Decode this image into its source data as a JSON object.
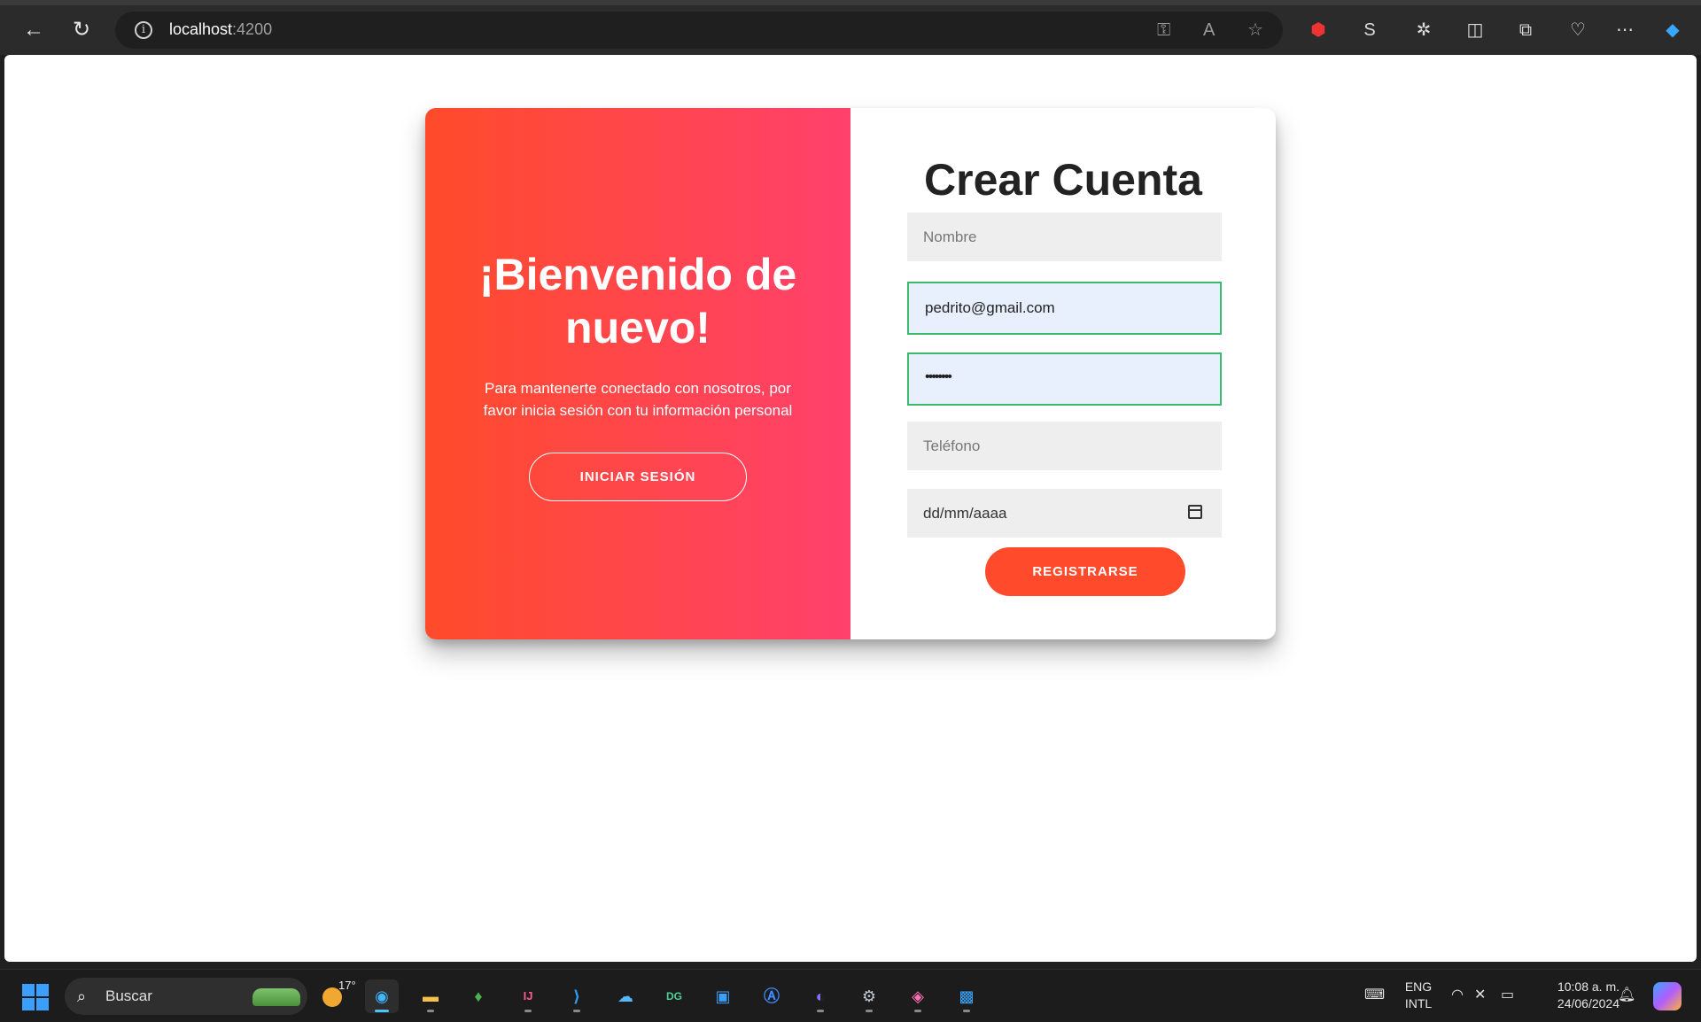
{
  "browser": {
    "url_host": "localhost",
    "url_port": ":4200"
  },
  "overlay": {
    "heading": "¡Bienvenido de nuevo!",
    "text": "Para mantenerte conectado con nosotros, por favor inicia sesión con tu información personal",
    "button": "INICIAR SESIÓN"
  },
  "form": {
    "title": "Crear Cuenta",
    "name_placeholder": "Nombre",
    "email_value": "pedrito@gmail.com",
    "password_value": "••••••••",
    "phone_placeholder": "Teléfono",
    "date_placeholder": "dd/mm/aaaa",
    "submit": "REGISTRARSE"
  },
  "taskbar": {
    "search_label": "Buscar",
    "weather_temp": "17°",
    "lang_line1": "ENG",
    "lang_line2": "INTL",
    "time": "10:08 a. m.",
    "date": "24/06/2024"
  },
  "colors": {
    "gradient_start": "#ff4b2b",
    "gradient_end": "#ff416c",
    "field_bg": "#eeeeee",
    "autofill_bg": "#e8f0fe",
    "valid_border": "#3cba6e"
  }
}
